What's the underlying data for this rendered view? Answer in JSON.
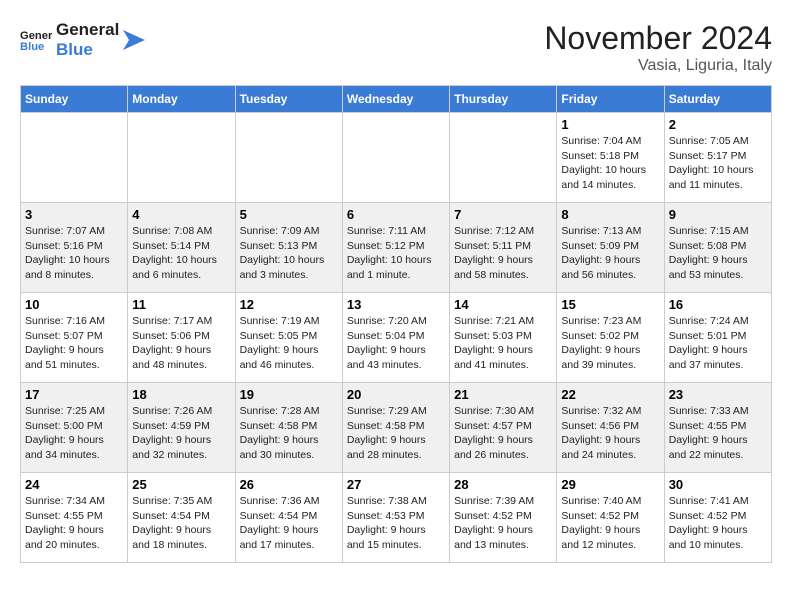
{
  "logo": {
    "line1": "General",
    "line2": "Blue"
  },
  "title": "November 2024",
  "location": "Vasia, Liguria, Italy",
  "weekdays": [
    "Sunday",
    "Monday",
    "Tuesday",
    "Wednesday",
    "Thursday",
    "Friday",
    "Saturday"
  ],
  "weeks": [
    [
      {
        "day": "",
        "info": ""
      },
      {
        "day": "",
        "info": ""
      },
      {
        "day": "",
        "info": ""
      },
      {
        "day": "",
        "info": ""
      },
      {
        "day": "",
        "info": ""
      },
      {
        "day": "1",
        "info": "Sunrise: 7:04 AM\nSunset: 5:18 PM\nDaylight: 10 hours and 14 minutes."
      },
      {
        "day": "2",
        "info": "Sunrise: 7:05 AM\nSunset: 5:17 PM\nDaylight: 10 hours and 11 minutes."
      }
    ],
    [
      {
        "day": "3",
        "info": "Sunrise: 7:07 AM\nSunset: 5:16 PM\nDaylight: 10 hours and 8 minutes."
      },
      {
        "day": "4",
        "info": "Sunrise: 7:08 AM\nSunset: 5:14 PM\nDaylight: 10 hours and 6 minutes."
      },
      {
        "day": "5",
        "info": "Sunrise: 7:09 AM\nSunset: 5:13 PM\nDaylight: 10 hours and 3 minutes."
      },
      {
        "day": "6",
        "info": "Sunrise: 7:11 AM\nSunset: 5:12 PM\nDaylight: 10 hours and 1 minute."
      },
      {
        "day": "7",
        "info": "Sunrise: 7:12 AM\nSunset: 5:11 PM\nDaylight: 9 hours and 58 minutes."
      },
      {
        "day": "8",
        "info": "Sunrise: 7:13 AM\nSunset: 5:09 PM\nDaylight: 9 hours and 56 minutes."
      },
      {
        "day": "9",
        "info": "Sunrise: 7:15 AM\nSunset: 5:08 PM\nDaylight: 9 hours and 53 minutes."
      }
    ],
    [
      {
        "day": "10",
        "info": "Sunrise: 7:16 AM\nSunset: 5:07 PM\nDaylight: 9 hours and 51 minutes."
      },
      {
        "day": "11",
        "info": "Sunrise: 7:17 AM\nSunset: 5:06 PM\nDaylight: 9 hours and 48 minutes."
      },
      {
        "day": "12",
        "info": "Sunrise: 7:19 AM\nSunset: 5:05 PM\nDaylight: 9 hours and 46 minutes."
      },
      {
        "day": "13",
        "info": "Sunrise: 7:20 AM\nSunset: 5:04 PM\nDaylight: 9 hours and 43 minutes."
      },
      {
        "day": "14",
        "info": "Sunrise: 7:21 AM\nSunset: 5:03 PM\nDaylight: 9 hours and 41 minutes."
      },
      {
        "day": "15",
        "info": "Sunrise: 7:23 AM\nSunset: 5:02 PM\nDaylight: 9 hours and 39 minutes."
      },
      {
        "day": "16",
        "info": "Sunrise: 7:24 AM\nSunset: 5:01 PM\nDaylight: 9 hours and 37 minutes."
      }
    ],
    [
      {
        "day": "17",
        "info": "Sunrise: 7:25 AM\nSunset: 5:00 PM\nDaylight: 9 hours and 34 minutes."
      },
      {
        "day": "18",
        "info": "Sunrise: 7:26 AM\nSunset: 4:59 PM\nDaylight: 9 hours and 32 minutes."
      },
      {
        "day": "19",
        "info": "Sunrise: 7:28 AM\nSunset: 4:58 PM\nDaylight: 9 hours and 30 minutes."
      },
      {
        "day": "20",
        "info": "Sunrise: 7:29 AM\nSunset: 4:58 PM\nDaylight: 9 hours and 28 minutes."
      },
      {
        "day": "21",
        "info": "Sunrise: 7:30 AM\nSunset: 4:57 PM\nDaylight: 9 hours and 26 minutes."
      },
      {
        "day": "22",
        "info": "Sunrise: 7:32 AM\nSunset: 4:56 PM\nDaylight: 9 hours and 24 minutes."
      },
      {
        "day": "23",
        "info": "Sunrise: 7:33 AM\nSunset: 4:55 PM\nDaylight: 9 hours and 22 minutes."
      }
    ],
    [
      {
        "day": "24",
        "info": "Sunrise: 7:34 AM\nSunset: 4:55 PM\nDaylight: 9 hours and 20 minutes."
      },
      {
        "day": "25",
        "info": "Sunrise: 7:35 AM\nSunset: 4:54 PM\nDaylight: 9 hours and 18 minutes."
      },
      {
        "day": "26",
        "info": "Sunrise: 7:36 AM\nSunset: 4:54 PM\nDaylight: 9 hours and 17 minutes."
      },
      {
        "day": "27",
        "info": "Sunrise: 7:38 AM\nSunset: 4:53 PM\nDaylight: 9 hours and 15 minutes."
      },
      {
        "day": "28",
        "info": "Sunrise: 7:39 AM\nSunset: 4:52 PM\nDaylight: 9 hours and 13 minutes."
      },
      {
        "day": "29",
        "info": "Sunrise: 7:40 AM\nSunset: 4:52 PM\nDaylight: 9 hours and 12 minutes."
      },
      {
        "day": "30",
        "info": "Sunrise: 7:41 AM\nSunset: 4:52 PM\nDaylight: 9 hours and 10 minutes."
      }
    ]
  ]
}
